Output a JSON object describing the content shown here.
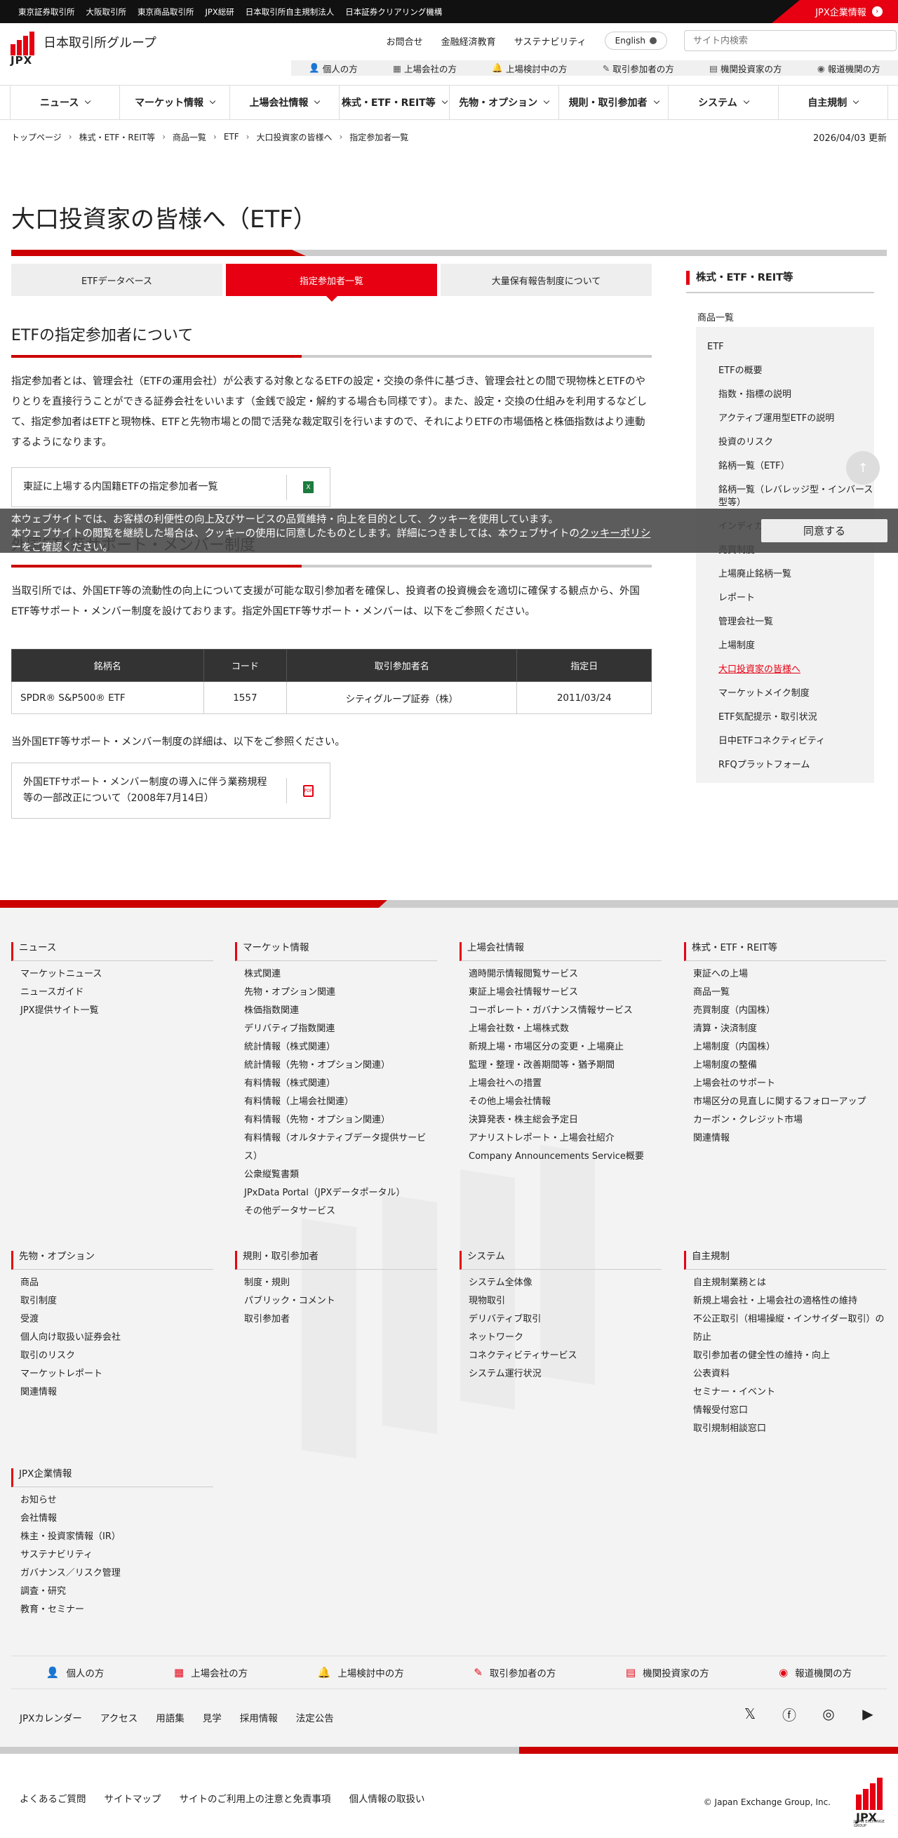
{
  "topbar": {
    "links": [
      "東京証券取引所",
      "大阪取引所",
      "東京商品取引所",
      "JPX総研",
      "日本取引所自主規制法人",
      "日本証券クリアリング機構"
    ],
    "jpx_info": "JPX企業情報"
  },
  "header": {
    "logo_text": "JPX",
    "group_name": "日本取引所グループ",
    "util_links": [
      "お問合せ",
      "金融経済教育",
      "サステナビリティ"
    ],
    "english": "English",
    "search_placeholder": "サイト内検索",
    "audience": [
      "個人の方",
      "上場会社の方",
      "上場検討中の方",
      "取引参加者の方",
      "機関投資家の方",
      "報道機関の方"
    ]
  },
  "gnav": [
    "ニュース",
    "マーケット情報",
    "上場会社情報",
    "株式・ETF・REIT等",
    "先物・オプション",
    "規則・取引参加者",
    "システム",
    "自主規制"
  ],
  "breadcrumb": [
    "トップページ",
    "株式・ETF・REIT等",
    "商品一覧",
    "ETF",
    "大口投資家の皆様へ",
    "指定参加者一覧"
  ],
  "updated": "2026/04/03 更新",
  "page_title": "大口投資家の皆様へ（ETF）",
  "tabs": [
    "ETFデータベース",
    "指定参加者一覧",
    "大量保有報告制度について"
  ],
  "section1": {
    "title": "ETFの指定参加者について",
    "text": "指定参加者とは、管理会社（ETFの運用会社）が公表する対象となるETFの設定・交換の条件に基づき、管理会社との間で現物株とETFのやりとりを直接行うことができる証券会社をいいます（金銭で設定・解約する場合も同様です）。また、設定・交換の仕組みを利用するなどして、指定参加者はETFと現物株、ETFと先物市場との間で活発な裁定取引を行いますので、それによりETFの市場価格と株価指数はより連動するようになります。",
    "file_label": "東証に上場する内国籍ETFの指定参加者一覧",
    "file_type": "XLS"
  },
  "section2": {
    "title": "外国ETF等サポート・メンバー制度",
    "text": "当取引所では、外国ETF等の流動性の向上について支援が可能な取引参加者を確保し、投資者の投資機会を適切に確保する観点から、外国ETF等サポート・メンバー制度を設けております。指定外国ETF等サポート・メンバーは、以下をご参照ください。",
    "table_headers": [
      "銘柄名",
      "コード",
      "取引参加者名",
      "指定日"
    ],
    "table_rows": [
      [
        "SPDR® S&P500® ETF",
        "1557",
        "シティグループ証券（株）",
        "2011/03/24"
      ]
    ],
    "note": "当外国ETF等サポート・メンバー制度の詳細は、以下をご参照ください。",
    "file_label": "外国ETFサポート・メンバー制度の導入に伴う業務規程等の一部改正について（2008年7月14日）",
    "file_type": "PDF"
  },
  "sidebar": {
    "heading": "株式・ETF・REIT等",
    "item1": "商品一覧",
    "item2": "ETF",
    "items": [
      "ETFの概要",
      "指数・指標の説明",
      "アクティブ運用型ETFの説明",
      "投資のリスク",
      "銘柄一覧（ETF）",
      "銘柄一覧（レバレッジ型・インバース型等）",
      "インディカティブNAV・PCF情報",
      "売買制度",
      "上場廃止銘柄一覧",
      "レポート",
      "管理会社一覧",
      "上場制度",
      "大口投資家の皆様へ",
      "マーケットメイク制度",
      "ETF気配提示・取引状況",
      "日中ETFコネクティビティ",
      "RFQプラットフォーム"
    ],
    "current_index": 12
  },
  "cookie": {
    "line1": "本ウェブサイトでは、お客様の利便性の向上及びサービスの品質維持・向上を目的として、クッキーを使用しています。",
    "line2a": "本ウェブサイトの閲覧を継続した場合は、クッキーの使用に同意したものとします。詳細につきましては、本ウェブサイトの",
    "line2link": "クッキーポリシ",
    "line3": "ーをご確認ください。",
    "accept": "同意する"
  },
  "footer": {
    "cols": [
      {
        "title": "ニュース",
        "links": [
          "マーケットニュース",
          "ニュースガイド",
          "JPX提供サイト一覧"
        ]
      },
      {
        "title": "マーケット情報",
        "links": [
          "株式関連",
          "先物・オプション関連",
          "株価指数関連",
          "デリバティブ指数関連",
          "統計情報（株式関連）",
          "統計情報（先物・オプション関連）",
          "有料情報（株式関連）",
          "有料情報（上場会社関連）",
          "有料情報（先物・オプション関連）",
          "有料情報（オルタナティブデータ提供サービス）",
          "公衆縦覧書類",
          "JPxData Portal（JPXデータポータル）",
          "その他データサービス"
        ]
      },
      {
        "title": "上場会社情報",
        "links": [
          "適時開示情報閲覧サービス",
          "東証上場会社情報サービス",
          "コーポレート・ガバナンス情報サービス",
          "上場会社数・上場株式数",
          "新規上場・市場区分の変更・上場廃止",
          "監理・整理・改善期間等・猶予期間",
          "上場会社への措置",
          "その他上場会社情報",
          "決算発表・株主総会予定日",
          "アナリストレポート・上場会社紹介",
          "Company Announcements Service概要"
        ]
      },
      {
        "title": "株式・ETF・REIT等",
        "links": [
          "東証への上場",
          "商品一覧",
          "売買制度（内国株）",
          "清算・決済制度",
          "上場制度（内国株）",
          "上場制度の整備",
          "上場会社のサポート",
          "市場区分の見直しに関するフォローアップ",
          "カーボン・クレジット市場",
          "関連情報"
        ]
      },
      {
        "title": "先物・オプション",
        "links": [
          "商品",
          "取引制度",
          "受渡",
          "個人向け取扱い証券会社",
          "取引のリスク",
          "マーケットレポート",
          "関連情報"
        ]
      },
      {
        "title": "規則・取引参加者",
        "links": [
          "制度・規則",
          "パブリック・コメント",
          "取引参加者"
        ]
      },
      {
        "title": "システム",
        "links": [
          "システム全体像",
          "現物取引",
          "デリバティブ取引",
          "ネットワーク",
          "コネクティビティサービス",
          "システム運行状況"
        ]
      },
      {
        "title": "自主規制",
        "links": [
          "自主規制業務とは",
          "新規上場会社・上場会社の適格性の維持",
          "不公正取引（相場操縦・インサイダー取引）の防止",
          "取引参加者の健全性の維持・向上",
          "公表資料",
          "セミナー・イベント",
          "情報受付窓口",
          "取引規制相談窓口"
        ]
      },
      {
        "title": "JPX企業情報",
        "links": [
          "お知らせ",
          "会社情報",
          "株主・投資家情報（IR）",
          "サステナビリティ",
          "ガバナンス／リスク管理",
          "調査・研究",
          "教育・セミナー"
        ]
      }
    ],
    "audience": [
      "個人の方",
      "上場会社の方",
      "上場検討中の方",
      "取引参加者の方",
      "機関投資家の方",
      "報道機関の方"
    ],
    "links": [
      "JPXカレンダー",
      "アクセス",
      "用語集",
      "見学",
      "採用情報",
      "法定公告"
    ],
    "bottom_links": [
      "よくあるご質問",
      "サイトマップ",
      "サイトのご利用上の注意と免責事項",
      "個人情報の取扱い"
    ],
    "copyright": "© Japan Exchange Group, Inc.",
    "logo_sub": "JAPAN EXCHANGE GROUP"
  }
}
